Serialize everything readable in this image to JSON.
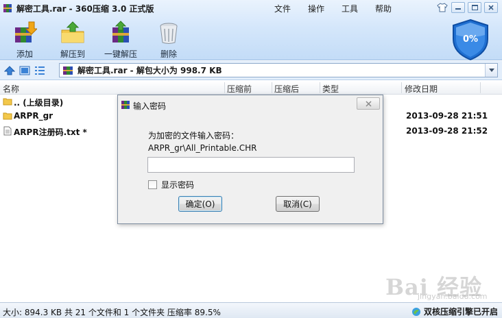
{
  "window": {
    "title": "解密工具.rar - 360压缩 3.0 正式版"
  },
  "menu": [
    "文件",
    "操作",
    "工具",
    "帮助"
  ],
  "toolbar": {
    "add": "添加",
    "extract": "解压到",
    "one_click_extract": "一键解压",
    "delete": "删除"
  },
  "shield": {
    "percent": "0%"
  },
  "address": {
    "path": "解密工具.rar - 解包大小为 998.7 KB"
  },
  "columns": {
    "name": "名称",
    "packed": "压缩前",
    "unpacked": "压缩后",
    "type": "类型",
    "modified": "修改日期"
  },
  "files": [
    {
      "name": ".. (上级目录)",
      "date": "",
      "icon": "folder-up-icon"
    },
    {
      "name": "ARPR_gr",
      "date": "2013-09-28 21:51",
      "icon": "folder-icon"
    },
    {
      "name": "ARPR注册码.txt *",
      "date": "2013-09-28 21:52",
      "icon": "text-file-icon"
    }
  ],
  "dialog": {
    "title": "输入密码",
    "prompt": "为加密的文件输入密码：",
    "file": "ARPR_gr\\All_Printable.CHR",
    "password_value": "",
    "show_password_label": "显示密码",
    "ok_label": "确定(O)",
    "cancel_label": "取消(C)"
  },
  "status": {
    "summary": "大小: 894.3 KB 共 21 个文件和 1 个文件夹 压缩率 89.5%",
    "engine": "双核压缩引擎已开启"
  },
  "watermark": {
    "text": "Bai 经验",
    "sub": "jingyan.baidu.com"
  },
  "colors": {
    "accent": "#2b6cc4",
    "shield": "#1f6fd1",
    "toolbar_bg": "#d5e7fb"
  }
}
